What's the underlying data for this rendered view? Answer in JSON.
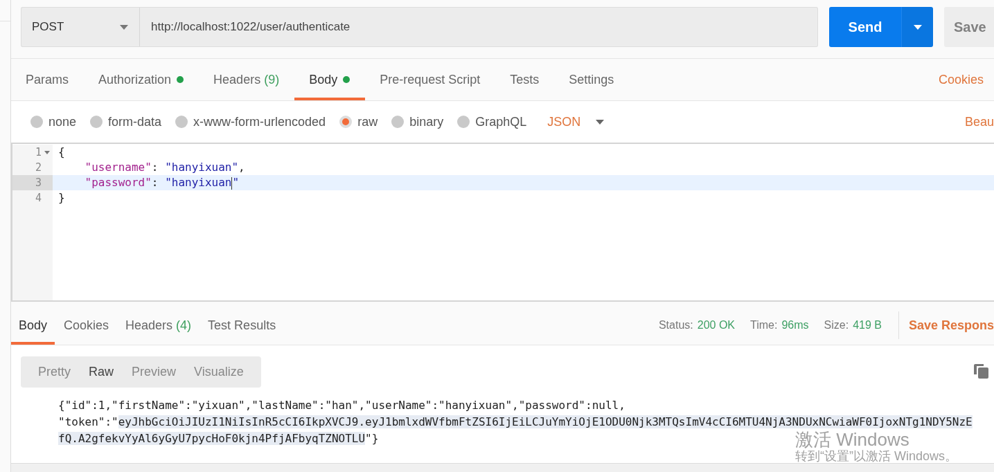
{
  "request": {
    "method": "POST",
    "url": "http://localhost:1022/user/authenticate",
    "send_label": "Send",
    "save_label": "Save"
  },
  "tabs": [
    {
      "label": "Params",
      "selected": false,
      "indicator": false
    },
    {
      "label": "Authorization",
      "selected": false,
      "indicator": true
    },
    {
      "label": "Headers",
      "count": "(9)",
      "selected": false,
      "indicator": false
    },
    {
      "label": "Body",
      "selected": true,
      "indicator": true
    },
    {
      "label": "Pre-request Script",
      "selected": false,
      "indicator": false
    },
    {
      "label": "Tests",
      "selected": false,
      "indicator": false
    },
    {
      "label": "Settings",
      "selected": false,
      "indicator": false
    }
  ],
  "cookies_link": "Cookies",
  "body_types": [
    {
      "label": "none",
      "selected": false
    },
    {
      "label": "form-data",
      "selected": false
    },
    {
      "label": "x-www-form-urlencoded",
      "selected": false
    },
    {
      "label": "raw",
      "selected": true
    },
    {
      "label": "binary",
      "selected": false
    },
    {
      "label": "GraphQL",
      "selected": false
    }
  ],
  "format": "JSON",
  "beautify_link": "Beau",
  "editor": {
    "lines": [
      {
        "number": "1",
        "foldable": true,
        "active": false,
        "tokens": [
          {
            "kind": "punct",
            "text": "{"
          }
        ]
      },
      {
        "number": "2",
        "foldable": false,
        "active": false,
        "tokens": [
          {
            "kind": "key",
            "text": "    \"username\""
          },
          {
            "kind": "punct",
            "text": ": "
          },
          {
            "kind": "string",
            "text": "\"hanyixuan\""
          },
          {
            "kind": "punct",
            "text": ","
          }
        ]
      },
      {
        "number": "3",
        "foldable": false,
        "active": true,
        "tokens": [
          {
            "kind": "key",
            "text": "    \"password\""
          },
          {
            "kind": "punct",
            "text": ": "
          },
          {
            "kind": "string",
            "text": "\"hanyixuan",
            "cursor_after": true
          },
          {
            "kind": "string",
            "text": "\""
          }
        ]
      },
      {
        "number": "4",
        "foldable": false,
        "active": false,
        "tokens": [
          {
            "kind": "punct",
            "text": "}"
          }
        ]
      }
    ]
  },
  "response": {
    "tabs": [
      {
        "label": "Body",
        "selected": true
      },
      {
        "label": "Cookies",
        "selected": false
      },
      {
        "label": "Headers",
        "count": "(4)",
        "selected": false
      },
      {
        "label": "Test Results",
        "selected": false
      }
    ],
    "stats": [
      {
        "label": "Status:",
        "value": "200 OK"
      },
      {
        "label": "Time:",
        "value": "96ms"
      },
      {
        "label": "Size:",
        "value": "419 B"
      }
    ],
    "save_link": "Save Respons",
    "view_modes": [
      {
        "label": "Pretty",
        "selected": false
      },
      {
        "label": "Raw",
        "selected": true
      },
      {
        "label": "Preview",
        "selected": false
      },
      {
        "label": "Visualize",
        "selected": false
      }
    ],
    "lines": [
      [
        {
          "text": "{\"id\":1,\"firstName\":\"yixuan\",\"lastName\":\"han\",\"userName\":\"hanyixuan\",\"password\":null,",
          "highlighted": false
        }
      ],
      [
        {
          "text": "\"token\":\"",
          "highlighted": false
        },
        {
          "text": "eyJhbGciOiJIUzI1NiIsInR5cCI6IkpXVCJ9.eyJ1bmlxdWVfbmFtZSI6IjEiLCJuYmYiOjE1ODU0Njk3MTQsImV4cCI6MTU4NjA3NDUxNCwiaWF0IjoxNTg1NDY5NzE",
          "highlighted": true
        }
      ],
      [
        {
          "text": "fQ.A2gfekvYyAl6yGyU7pycHoF0kjn4PfjAFbyqTZNOTLU",
          "highlighted": true
        },
        {
          "text": "\"}",
          "highlighted": false
        }
      ]
    ]
  },
  "activation_notice": {
    "title": "激活 Windows",
    "message": "转到“设置”以激活 Windows。"
  }
}
